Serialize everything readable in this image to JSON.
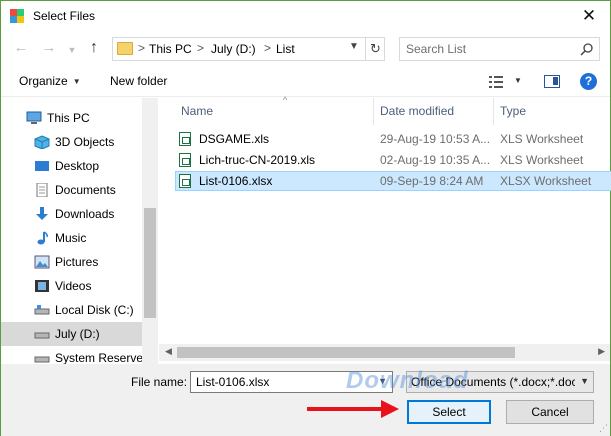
{
  "window": {
    "title": "Select Files",
    "close_glyph": "✕"
  },
  "address": {
    "crumbs": [
      "This PC",
      "July (D:)",
      "List"
    ],
    "separator": ">"
  },
  "search": {
    "placeholder": "Search List"
  },
  "toolbar": {
    "organize_label": "Organize",
    "new_folder_label": "New folder",
    "help_label": "?"
  },
  "navpane": {
    "items": [
      {
        "label": "This PC",
        "icon": "computer-icon"
      },
      {
        "label": "3D Objects",
        "icon": "cube-icon"
      },
      {
        "label": "Desktop",
        "icon": "desktop-icon"
      },
      {
        "label": "Documents",
        "icon": "documents-icon"
      },
      {
        "label": "Downloads",
        "icon": "download-arrow-icon"
      },
      {
        "label": "Music",
        "icon": "music-note-icon"
      },
      {
        "label": "Pictures",
        "icon": "pictures-icon"
      },
      {
        "label": "Videos",
        "icon": "videos-icon"
      },
      {
        "label": "Local Disk (C:)",
        "icon": "drive-icon"
      },
      {
        "label": "July (D:)",
        "icon": "drive-icon",
        "selected": true
      },
      {
        "label": "System Reserved",
        "icon": "drive-icon"
      }
    ]
  },
  "columns": {
    "name": "Name",
    "date": "Date modified",
    "type": "Type"
  },
  "files": [
    {
      "name": "DSGAME.xls",
      "date": "29-Aug-19 10:53 A...",
      "type": "XLS Worksheet"
    },
    {
      "name": "Lich-truc-CN-2019.xls",
      "date": "02-Aug-19 10:35 A...",
      "type": "XLS Worksheet"
    },
    {
      "name": "List-0106.xlsx",
      "date": "09-Sep-19 8:24 AM",
      "type": "XLSX Worksheet",
      "selected": true
    }
  ],
  "bottom": {
    "file_name_label": "File name:",
    "file_name_value": "List-0106.xlsx",
    "filter_value": "Office Documents (*.docx;*.doc",
    "select_label": "Select",
    "cancel_label": "Cancel",
    "watermark": "Download"
  },
  "colors": {
    "accent": "#0078d7",
    "selection": "#cce8ff",
    "arrow": "#e8121b",
    "excel": "#1e7145"
  }
}
